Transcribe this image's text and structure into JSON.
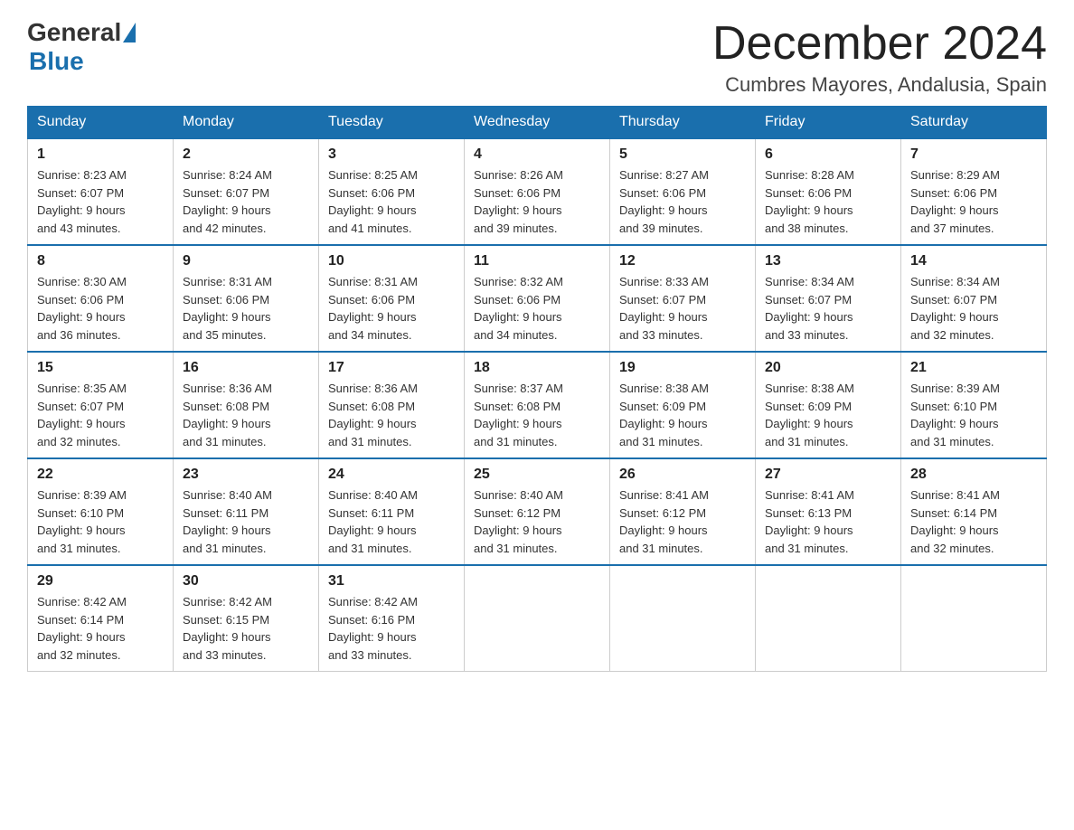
{
  "header": {
    "logo_general": "General",
    "logo_blue": "Blue",
    "month_title": "December 2024",
    "location": "Cumbres Mayores, Andalusia, Spain"
  },
  "days_of_week": [
    "Sunday",
    "Monday",
    "Tuesday",
    "Wednesday",
    "Thursday",
    "Friday",
    "Saturday"
  ],
  "weeks": [
    [
      {
        "day": "1",
        "sunrise": "8:23 AM",
        "sunset": "6:07 PM",
        "daylight": "9 hours and 43 minutes."
      },
      {
        "day": "2",
        "sunrise": "8:24 AM",
        "sunset": "6:07 PM",
        "daylight": "9 hours and 42 minutes."
      },
      {
        "day": "3",
        "sunrise": "8:25 AM",
        "sunset": "6:06 PM",
        "daylight": "9 hours and 41 minutes."
      },
      {
        "day": "4",
        "sunrise": "8:26 AM",
        "sunset": "6:06 PM",
        "daylight": "9 hours and 39 minutes."
      },
      {
        "day": "5",
        "sunrise": "8:27 AM",
        "sunset": "6:06 PM",
        "daylight": "9 hours and 39 minutes."
      },
      {
        "day": "6",
        "sunrise": "8:28 AM",
        "sunset": "6:06 PM",
        "daylight": "9 hours and 38 minutes."
      },
      {
        "day": "7",
        "sunrise": "8:29 AM",
        "sunset": "6:06 PM",
        "daylight": "9 hours and 37 minutes."
      }
    ],
    [
      {
        "day": "8",
        "sunrise": "8:30 AM",
        "sunset": "6:06 PM",
        "daylight": "9 hours and 36 minutes."
      },
      {
        "day": "9",
        "sunrise": "8:31 AM",
        "sunset": "6:06 PM",
        "daylight": "9 hours and 35 minutes."
      },
      {
        "day": "10",
        "sunrise": "8:31 AM",
        "sunset": "6:06 PM",
        "daylight": "9 hours and 34 minutes."
      },
      {
        "day": "11",
        "sunrise": "8:32 AM",
        "sunset": "6:06 PM",
        "daylight": "9 hours and 34 minutes."
      },
      {
        "day": "12",
        "sunrise": "8:33 AM",
        "sunset": "6:07 PM",
        "daylight": "9 hours and 33 minutes."
      },
      {
        "day": "13",
        "sunrise": "8:34 AM",
        "sunset": "6:07 PM",
        "daylight": "9 hours and 33 minutes."
      },
      {
        "day": "14",
        "sunrise": "8:34 AM",
        "sunset": "6:07 PM",
        "daylight": "9 hours and 32 minutes."
      }
    ],
    [
      {
        "day": "15",
        "sunrise": "8:35 AM",
        "sunset": "6:07 PM",
        "daylight": "9 hours and 32 minutes."
      },
      {
        "day": "16",
        "sunrise": "8:36 AM",
        "sunset": "6:08 PM",
        "daylight": "9 hours and 31 minutes."
      },
      {
        "day": "17",
        "sunrise": "8:36 AM",
        "sunset": "6:08 PM",
        "daylight": "9 hours and 31 minutes."
      },
      {
        "day": "18",
        "sunrise": "8:37 AM",
        "sunset": "6:08 PM",
        "daylight": "9 hours and 31 minutes."
      },
      {
        "day": "19",
        "sunrise": "8:38 AM",
        "sunset": "6:09 PM",
        "daylight": "9 hours and 31 minutes."
      },
      {
        "day": "20",
        "sunrise": "8:38 AM",
        "sunset": "6:09 PM",
        "daylight": "9 hours and 31 minutes."
      },
      {
        "day": "21",
        "sunrise": "8:39 AM",
        "sunset": "6:10 PM",
        "daylight": "9 hours and 31 minutes."
      }
    ],
    [
      {
        "day": "22",
        "sunrise": "8:39 AM",
        "sunset": "6:10 PM",
        "daylight": "9 hours and 31 minutes."
      },
      {
        "day": "23",
        "sunrise": "8:40 AM",
        "sunset": "6:11 PM",
        "daylight": "9 hours and 31 minutes."
      },
      {
        "day": "24",
        "sunrise": "8:40 AM",
        "sunset": "6:11 PM",
        "daylight": "9 hours and 31 minutes."
      },
      {
        "day": "25",
        "sunrise": "8:40 AM",
        "sunset": "6:12 PM",
        "daylight": "9 hours and 31 minutes."
      },
      {
        "day": "26",
        "sunrise": "8:41 AM",
        "sunset": "6:12 PM",
        "daylight": "9 hours and 31 minutes."
      },
      {
        "day": "27",
        "sunrise": "8:41 AM",
        "sunset": "6:13 PM",
        "daylight": "9 hours and 31 minutes."
      },
      {
        "day": "28",
        "sunrise": "8:41 AM",
        "sunset": "6:14 PM",
        "daylight": "9 hours and 32 minutes."
      }
    ],
    [
      {
        "day": "29",
        "sunrise": "8:42 AM",
        "sunset": "6:14 PM",
        "daylight": "9 hours and 32 minutes."
      },
      {
        "day": "30",
        "sunrise": "8:42 AM",
        "sunset": "6:15 PM",
        "daylight": "9 hours and 33 minutes."
      },
      {
        "day": "31",
        "sunrise": "8:42 AM",
        "sunset": "6:16 PM",
        "daylight": "9 hours and 33 minutes."
      },
      null,
      null,
      null,
      null
    ]
  ],
  "labels": {
    "sunrise": "Sunrise:",
    "sunset": "Sunset:",
    "daylight": "Daylight:"
  }
}
